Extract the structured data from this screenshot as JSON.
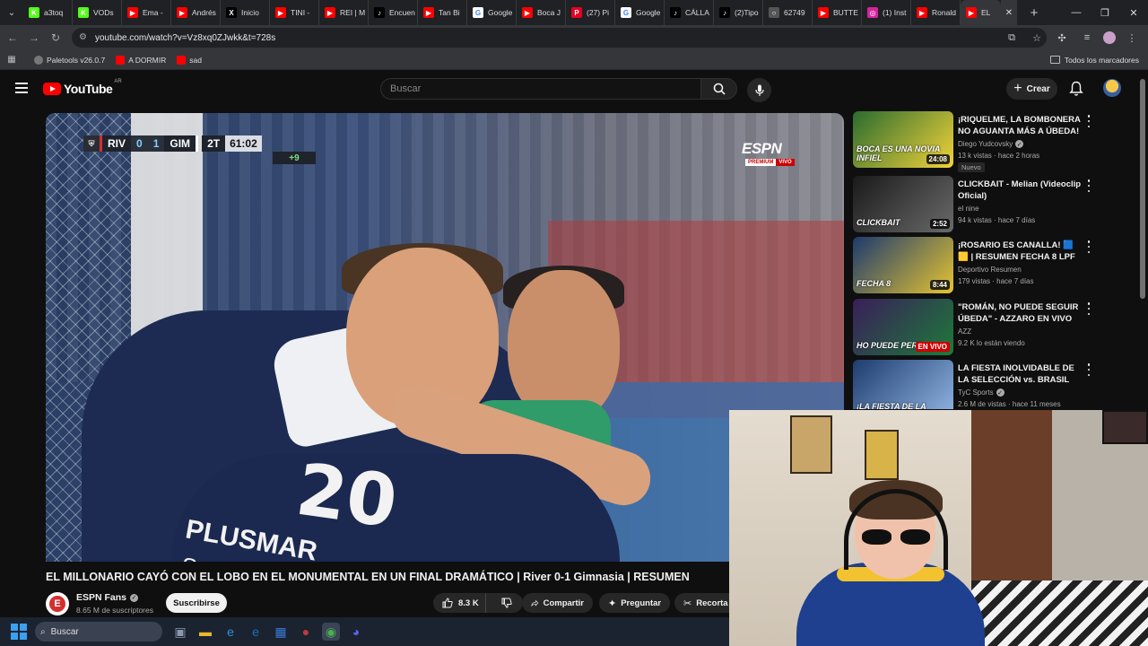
{
  "browser": {
    "tabs": [
      {
        "label": "a3toq",
        "icon": "kick-icon",
        "color": "#53fc18",
        "glyph": "K"
      },
      {
        "label": "VODs",
        "icon": "kick-icon",
        "color": "#53fc18",
        "glyph": "K"
      },
      {
        "label": "Ema -",
        "icon": "youtube-icon",
        "color": "#ff0000",
        "glyph": "▶"
      },
      {
        "label": "Andrés",
        "icon": "youtube-icon",
        "color": "#ff0000",
        "glyph": "▶"
      },
      {
        "label": "Inicio",
        "icon": "x-icon",
        "color": "#000000",
        "glyph": "X"
      },
      {
        "label": "TINI -",
        "icon": "youtube-icon",
        "color": "#ff0000",
        "glyph": "▶"
      },
      {
        "label": "REI | M",
        "icon": "youtube-icon",
        "color": "#ff0000",
        "glyph": "▶"
      },
      {
        "label": "Encuen",
        "icon": "tiktok-icon",
        "color": "#000000",
        "glyph": "♪"
      },
      {
        "label": "Tan Bi",
        "icon": "youtube-icon",
        "color": "#ff0000",
        "glyph": "▶"
      },
      {
        "label": "Google",
        "icon": "google-icon",
        "color": "#ffffff",
        "glyph": "G"
      },
      {
        "label": "Boca J",
        "icon": "youtube-icon",
        "color": "#ff0000",
        "glyph": "▶"
      },
      {
        "label": "(27) Pi",
        "icon": "pinterest-icon",
        "color": "#e60023",
        "glyph": "P"
      },
      {
        "label": "Google",
        "icon": "google-icon",
        "color": "#ffffff",
        "glyph": "G"
      },
      {
        "label": "CÁLLA",
        "icon": "tiktok-icon",
        "color": "#000000",
        "glyph": "♪"
      },
      {
        "label": "(2)Tipo",
        "icon": "tiktok-icon",
        "color": "#000000",
        "glyph": "♪"
      },
      {
        "label": "62749",
        "icon": "loading-icon",
        "color": "#555555",
        "glyph": "○"
      },
      {
        "label": "BUTTE",
        "icon": "youtube-icon",
        "color": "#ff0000",
        "glyph": "▶"
      },
      {
        "label": "(1) Inst",
        "icon": "instagram-icon",
        "color": "#d6249f",
        "glyph": "◎"
      },
      {
        "label": "Ronald",
        "icon": "youtube-icon",
        "color": "#ff0000",
        "glyph": "▶"
      }
    ],
    "active_tab": {
      "label": "EL",
      "icon": "youtube-icon",
      "color": "#ff0000",
      "glyph": "▶"
    },
    "url": "youtube.com/watch?v=Vz8xq0ZJwkk&t=728s",
    "bookmarks": [
      {
        "label": "Paletools v26.0.7",
        "color": "#888888"
      },
      {
        "label": "A DORMIR",
        "color": "#ff0000"
      },
      {
        "label": "sad",
        "color": "#ff0000"
      }
    ],
    "all_bookmarks": "Todos los marcadores"
  },
  "youtube": {
    "logo_text": "YouTube",
    "country_code": "AR",
    "search_placeholder": "Buscar",
    "create_label": "Crear"
  },
  "video": {
    "scorebug": {
      "home": "RIV",
      "home_score": "0",
      "away_score": "1",
      "away": "GIM",
      "half": "2T",
      "clock": "61:02",
      "added": "+9"
    },
    "broadcaster": "ESPN",
    "broadcaster_sub_a": "PREMIUM",
    "broadcaster_sub_b": "VIVO",
    "jersey_number": "20",
    "jersey_sponsor": "PLUSMAR",
    "jersey_sponsor_2": "Sportsbet",
    "title": "EL MILLONARIO CAYÓ CON EL LOBO EN EL MONUMENTAL EN UN FINAL DRAMÁTICO | River 0-1 Gimnasia | RESUMEN",
    "channel": "ESPN Fans",
    "subscribers": "8.65 M de suscriptores",
    "subscribe_label": "Suscribirse",
    "likes": "8.3 K",
    "share_label": "Compartir",
    "ask_label": "Preguntar",
    "clip_label": "Recorta"
  },
  "recommendations": [
    {
      "title": "¡RIQUELME, LA BOMBONERA NO AGUANTA MÁS A ÚBEDA! ...",
      "channel": "Diego Yudcovsky",
      "verified": true,
      "meta": "13 k vistas · hace 2 horas",
      "badge": "Nuevo",
      "duration": "24:08",
      "thumb_text": "BOCA ES UNA NOVIA INFIEL",
      "thumb_colors": [
        "#2a6b2f",
        "#f2d33a"
      ]
    },
    {
      "title": "CLICKBAIT - Melian (Videoclip Oficial)",
      "channel": "el nine",
      "verified": false,
      "meta": "94 k vistas · hace 7 días",
      "badge": "",
      "duration": "2:52",
      "thumb_text": "CLICKBAIT",
      "thumb_colors": [
        "#1a1a1a",
        "#6a6a6a"
      ]
    },
    {
      "title": "¡ROSARIO ES CANALLA! 🟦🟨 | RESUMEN FECHA 8 LPF",
      "channel": "Deportivo Resumen",
      "verified": false,
      "meta": "179 vistas · hace 7 días",
      "badge": "",
      "duration": "8:44",
      "thumb_text": "FECHA 8",
      "thumb_colors": [
        "#1c3a6e",
        "#e5c431"
      ]
    },
    {
      "title": "\"ROMÁN, NO PUEDE SEGUIR ÚBEDA\" - AZZARO EN VIVO E...",
      "channel": "AZZ",
      "verified": false,
      "meta": "9.2 K lo están viendo",
      "badge": "",
      "duration": "",
      "live": "EN VIVO",
      "thumb_text": "HO PUEDE PERD",
      "thumb_colors": [
        "#3a1e5a",
        "#1d7a3a"
      ]
    },
    {
      "title": "LA FIESTA INOLVIDABLE DE LA SELECCIÓN vs. BRASIL 🕺 🔥...",
      "channel": "TyC Sports",
      "verified": true,
      "meta": "2.6 M de vistas · hace 11 meses",
      "badge": "",
      "duration": "",
      "thumb_text": "¡LA FIESTA DE LA",
      "thumb_colors": [
        "#1e3c6e",
        "#8fb4e2"
      ]
    }
  ],
  "taskbar": {
    "search_placeholder": "Buscar",
    "apps": [
      {
        "icon": "task-view-icon",
        "glyph": "▣",
        "color": "#8a97ad"
      },
      {
        "icon": "file-explorer-icon",
        "glyph": "▬",
        "color": "#e8b730"
      },
      {
        "icon": "edge-icon",
        "glyph": "e",
        "color": "#2c8fd6"
      },
      {
        "icon": "edge-blue-icon",
        "glyph": "e",
        "color": "#1f6fb5"
      },
      {
        "icon": "store-icon",
        "glyph": "▦",
        "color": "#3a7ad6"
      },
      {
        "icon": "app-red-icon",
        "glyph": "●",
        "color": "#c23a3a"
      },
      {
        "icon": "chrome-icon",
        "glyph": "◉",
        "color": "#4caf50"
      },
      {
        "icon": "discord-icon",
        "glyph": "◕",
        "color": "#5865f2"
      }
    ]
  }
}
